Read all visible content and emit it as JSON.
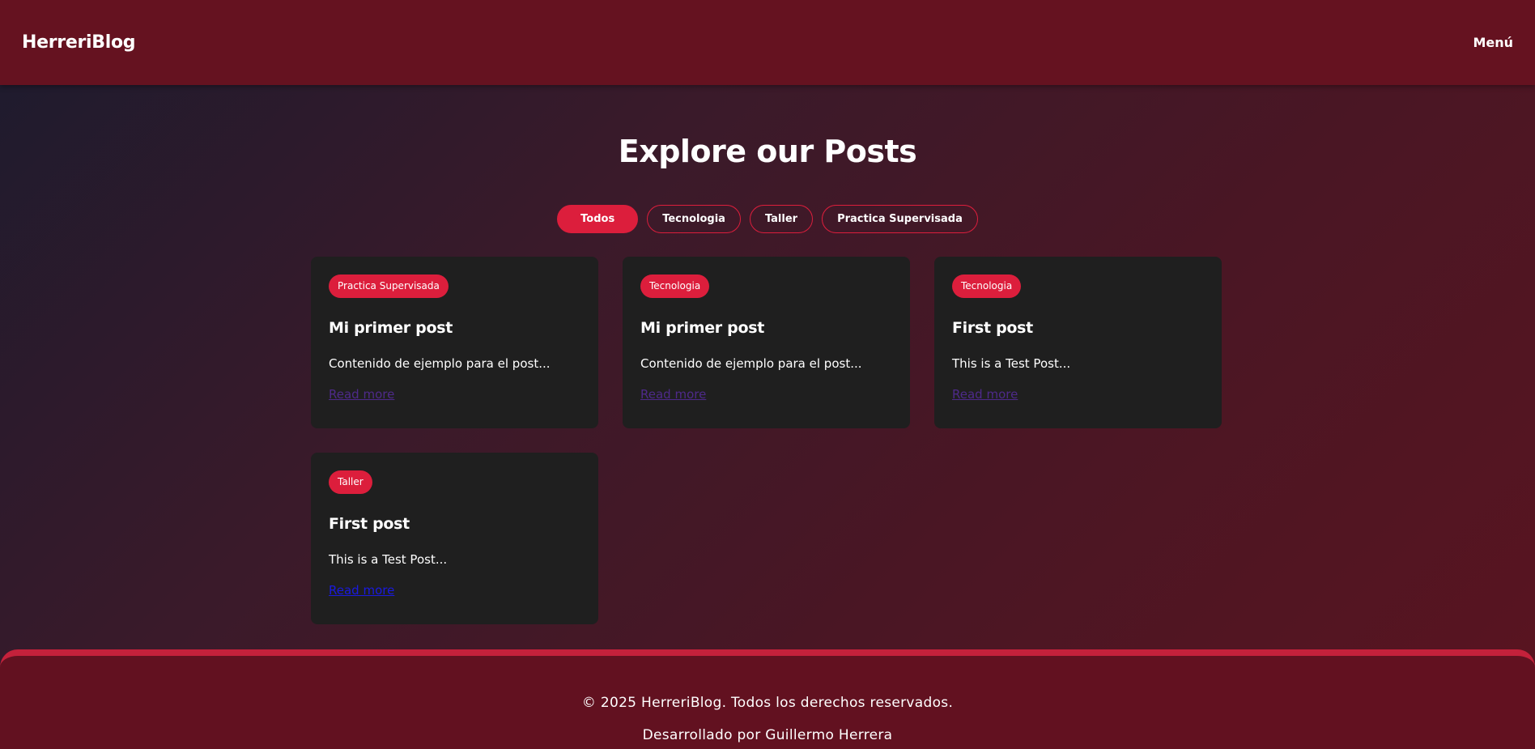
{
  "header": {
    "brand": "HerreriBlog",
    "menu_label": "Menú"
  },
  "main": {
    "title": "Explore our Posts",
    "filters": [
      {
        "label": "Todos",
        "active": true
      },
      {
        "label": "Tecnologia",
        "active": false
      },
      {
        "label": "Taller",
        "active": false
      },
      {
        "label": "Practica Supervisada",
        "active": false
      }
    ],
    "posts": [
      {
        "category": "Practica Supervisada",
        "title": "Mi primer post",
        "excerpt": "Contenido de ejemplo para el post...",
        "link": "Read more"
      },
      {
        "category": "Tecnologia",
        "title": "Mi primer post",
        "excerpt": "Contenido de ejemplo para el post...",
        "link": "Read more"
      },
      {
        "category": "Tecnologia",
        "title": "First post",
        "excerpt": "This is a Test Post...",
        "link": "Read more"
      },
      {
        "category": "Taller",
        "title": "First post",
        "excerpt": "This is a Test Post...",
        "link": "Read more"
      }
    ]
  },
  "footer": {
    "copyright": "© 2025 HerreriBlog. Todos los derechos reservados.",
    "credit": "Desarrollado por Guillermo Herrera"
  },
  "colors": {
    "header_bg": "#651220",
    "accent": "#dc1e3c",
    "card_bg": "#1f1f1f",
    "link_visited": "#4e2a8a",
    "link_unvisited": "#1a1ae0"
  }
}
